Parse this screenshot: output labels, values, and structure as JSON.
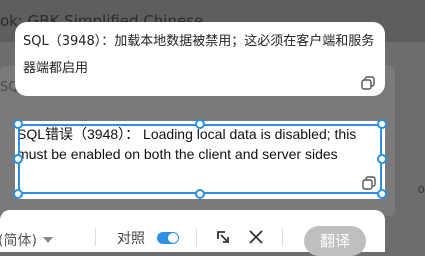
{
  "background": {
    "header_text": "ok: GBK Simplified Chinese",
    "side_text": "SQ",
    "right_text": "o"
  },
  "source": {
    "text": "SQL（3948）：加载本地数据被禁用；这必须在客户端和服务器端都启用"
  },
  "translation": {
    "text": "SQL错误（3948）： Loading local data is disabled; this must be enabled on both the client and server sides"
  },
  "toolbar": {
    "language_label": "(简体)",
    "compare_label": "对照",
    "compare_enabled": true,
    "translate_label": "翻译"
  },
  "colors": {
    "accent": "#2d8fe6",
    "translate_button": "#bfbfbf"
  }
}
